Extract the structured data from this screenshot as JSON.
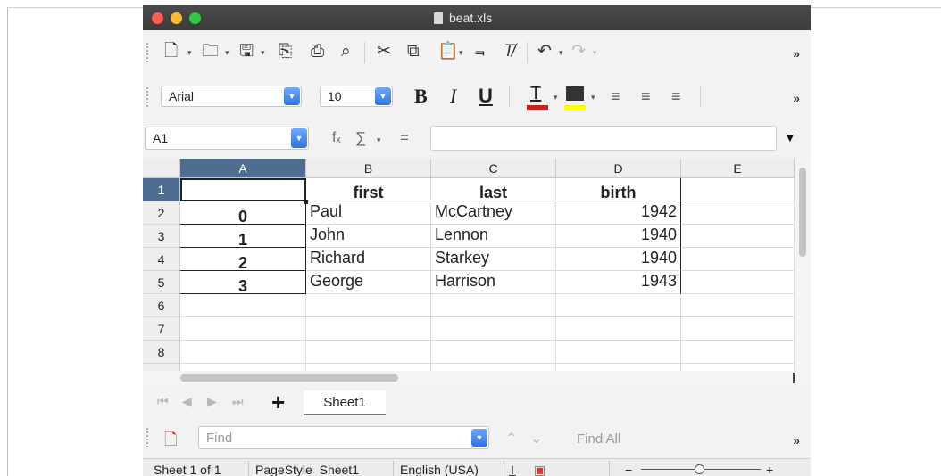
{
  "window": {
    "title": "beat.xls"
  },
  "toolbar": {
    "overflow": "»"
  },
  "font": {
    "family": "Arial",
    "size": "10"
  },
  "formula_bar": {
    "cell_ref": "A1",
    "fx": "fₓ",
    "sum": "∑",
    "equals": "=",
    "content": ""
  },
  "columns": [
    "A",
    "B",
    "C",
    "D",
    "E"
  ],
  "rows": [
    "1",
    "2",
    "3",
    "4",
    "5",
    "6",
    "7",
    "8"
  ],
  "cells": {
    "B1": "first",
    "C1": "last",
    "D1": "birth",
    "A2": "0",
    "B2": "Paul",
    "C2": "McCartney",
    "D2": "1942",
    "A3": "1",
    "B3": "John",
    "C3": "Lennon",
    "D3": "1940",
    "A4": "2",
    "B4": "Richard",
    "C4": "Starkey",
    "D4": "1940",
    "A5": "3",
    "B5": "George",
    "C5": "Harrison",
    "D5": "1943"
  },
  "sheet_tabs": {
    "add": "+",
    "active": "Sheet1"
  },
  "find": {
    "placeholder": "Find",
    "find_all": "Find All"
  },
  "status": {
    "sheet": "Sheet 1 of 1",
    "page_style": "PageStyle_Sheet1",
    "language": "English (USA)",
    "zoom_minus": "−",
    "zoom_plus": "+"
  },
  "colors": {
    "selected_header": "#4f6d91",
    "accent": "#2f73e0",
    "font_color": "#c9211e",
    "highlight": "#ffff00"
  }
}
